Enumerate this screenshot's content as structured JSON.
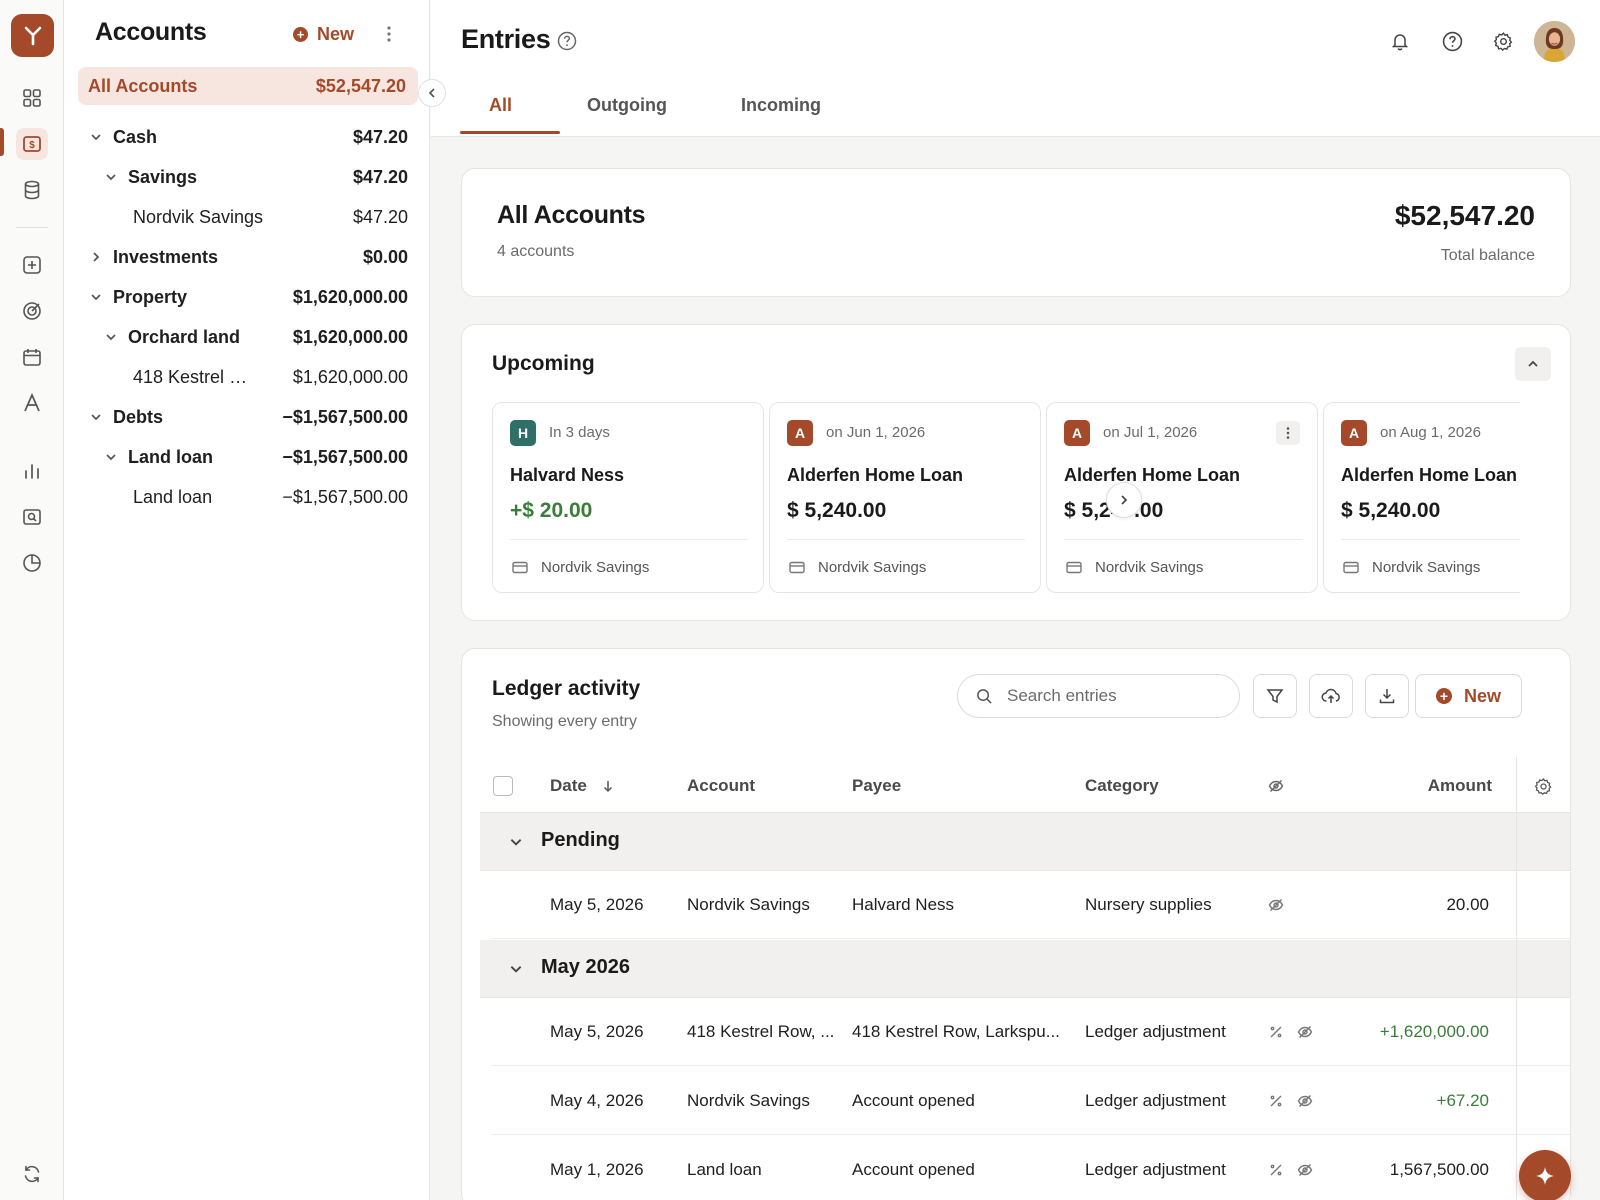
{
  "accent_color": "#a4492a",
  "rail": {
    "icons": [
      "logo-icon",
      "dashboard-icon",
      "accounts-icon",
      "database-icon",
      "add-icon",
      "target-icon",
      "calendar-icon",
      "font-icon",
      "bar-chart-icon",
      "search-doc-icon",
      "pie-chart-icon",
      "sync-icon"
    ]
  },
  "accounts": {
    "title": "Accounts",
    "new_label": "New",
    "all": {
      "label": "All Accounts",
      "amount": "$52,547.20"
    },
    "tree": [
      {
        "label": "Cash",
        "amount": "$47.20"
      },
      {
        "label": "Savings",
        "amount": "$47.20"
      },
      {
        "label": "Nordvik Savings",
        "amount": "$47.20"
      },
      {
        "label": "Investments",
        "amount": "$0.00"
      },
      {
        "label": "Property",
        "amount": "$1,620,000.00"
      },
      {
        "label": "Orchard land",
        "amount": "$1,620,000.00"
      },
      {
        "label": "418 Kestrel R...",
        "amount": "$1,620,000.00"
      },
      {
        "label": "Debts",
        "amount": "−$1,567,500.00"
      },
      {
        "label": "Land loan",
        "amount": "−$1,567,500.00"
      },
      {
        "label": "Land loan",
        "amount": "−$1,567,500.00"
      }
    ]
  },
  "header": {
    "title": "Entries",
    "tabs": [
      {
        "label": "All",
        "active": true
      },
      {
        "label": "Outgoing",
        "active": false
      },
      {
        "label": "Incoming",
        "active": false
      }
    ]
  },
  "summary": {
    "title": "All Accounts",
    "subtitle": "4 accounts",
    "balance": "$52,547.20",
    "balance_label": "Total balance"
  },
  "upcoming": {
    "title": "Upcoming",
    "cards": [
      {
        "badge": "H",
        "badge_color": "#2f6f67",
        "when": "In 3 days",
        "name": "Halvard Ness",
        "amount": "+$ 20.00",
        "positive": true,
        "account": "Nordvik Savings"
      },
      {
        "badge": "A",
        "badge_color": "#a4492a",
        "when": "on Jun 1, 2026",
        "name": "Alderfen Home Loan",
        "amount": "$ 5,240.00",
        "positive": false,
        "account": "Nordvik Savings"
      },
      {
        "badge": "A",
        "badge_color": "#a4492a",
        "when": "on Jul 1, 2026",
        "name": "Alderfen Home Loan",
        "amount": "$ 5,240.00",
        "positive": false,
        "account": "Nordvik Savings"
      },
      {
        "badge": "A",
        "badge_color": "#a4492a",
        "when": "on Aug 1, 2026",
        "name": "Alderfen Home Loan",
        "amount": "$ 5,240.00",
        "positive": false,
        "account": "Nordvik Savings"
      }
    ]
  },
  "ledger": {
    "title": "Ledger activity",
    "subtitle": "Showing every entry",
    "search_placeholder": "Search entries",
    "new_label": "New",
    "columns": {
      "date": "Date",
      "account": "Account",
      "payee": "Payee",
      "category": "Category",
      "amount": "Amount"
    },
    "groups": [
      {
        "label": "Pending"
      },
      {
        "label": "May 2026"
      }
    ],
    "pending_rows": [
      {
        "date": "May 5, 2026",
        "account": "Nordvik Savings",
        "payee": "Halvard Ness",
        "category": "Nursery supplies",
        "amount": "20.00",
        "positive": false
      }
    ],
    "month_rows": [
      {
        "date": "May 5, 2026",
        "account": "418 Kestrel Row, ...",
        "payee": "418 Kestrel Row, Larkspu...",
        "category": "Ledger adjustment",
        "amount": "+1,620,000.00",
        "positive": true
      },
      {
        "date": "May 4, 2026",
        "account": "Nordvik Savings",
        "payee": "Account opened",
        "category": "Ledger adjustment",
        "amount": "+67.20",
        "positive": true
      },
      {
        "date": "May 1, 2026",
        "account": "Land loan",
        "payee": "Account opened",
        "category": "Ledger adjustment",
        "amount": "1,567,500.00",
        "positive": false
      }
    ]
  }
}
